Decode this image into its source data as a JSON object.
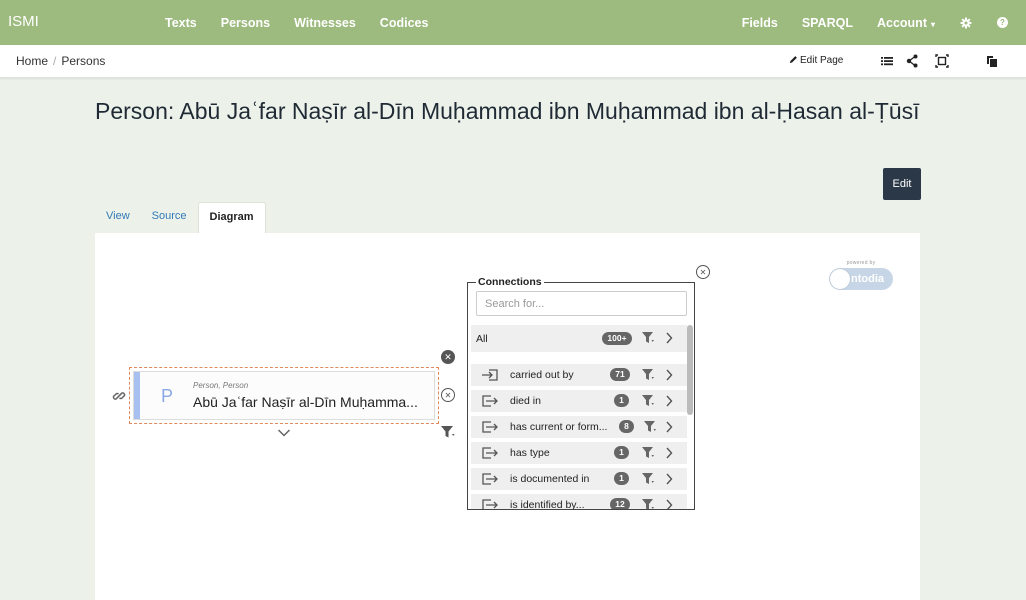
{
  "navbar": {
    "brand": "ISMI",
    "left_items": [
      "Texts",
      "Persons",
      "Witnesses",
      "Codices"
    ],
    "fields": "Fields",
    "sparql": "SPARQL",
    "account": "Account",
    "icons": [
      "gear-icon",
      "help-icon"
    ],
    "help_glyph": "?",
    "caret": "▾",
    "bg_color": "#9dba7f"
  },
  "breadcrumb": {
    "home": "Home",
    "separator": "/",
    "current": "Persons"
  },
  "toolbar": {
    "edit_page": "Edit Page",
    "icons": [
      "list-icon",
      "graph-icon",
      "fit-screen-icon",
      "copy-icon"
    ]
  },
  "page": {
    "title": "Person: Abū Jaʿfar Naṣīr al-Dīn Muḥammad ibn Muḥammad ibn al-Ḥasan al-Ṭūsī",
    "edit_button": "Edit"
  },
  "tabs": [
    {
      "label": "View",
      "active": false
    },
    {
      "label": "Source",
      "active": false
    },
    {
      "label": "Diagram",
      "active": true
    }
  ],
  "logo": {
    "powered_by": "powered by",
    "name": "ntodia"
  },
  "node": {
    "letter": "P",
    "types": "Person, Person",
    "label": "Abū Jaʿfar Naṣīr al-Dīn Muḥamma...",
    "stripe_color": "#a7c0ef",
    "border_color": "#e08a5c"
  },
  "connections": {
    "title": "Connections",
    "search_placeholder": "Search for...",
    "all": {
      "label": "All",
      "count": "100+"
    },
    "rows": [
      {
        "label": "carried out by",
        "count": "71",
        "direction": "in"
      },
      {
        "label": "died in",
        "count": "1",
        "direction": "out"
      },
      {
        "label": "has current or form...",
        "count": "8",
        "direction": "out"
      },
      {
        "label": "has type",
        "count": "1",
        "direction": "out"
      },
      {
        "label": "is documented in",
        "count": "1",
        "direction": "out"
      },
      {
        "label": "is identified by...",
        "count": "12",
        "direction": "out"
      }
    ]
  },
  "close_glyph": "✕"
}
